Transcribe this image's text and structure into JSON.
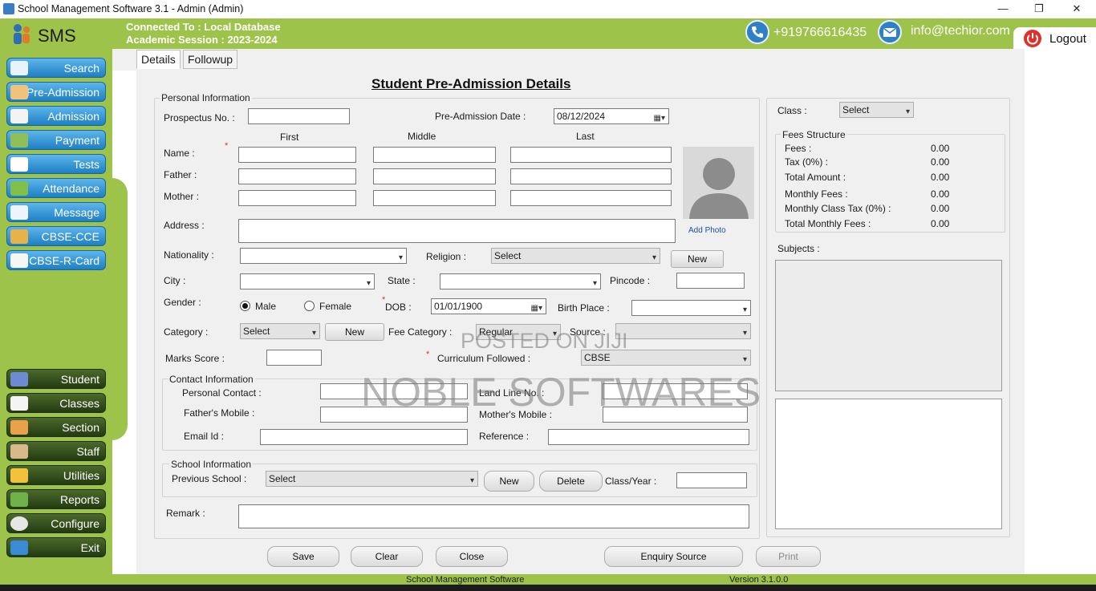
{
  "window": {
    "title": "School Management Software 3.1  -  Admin (Admin)",
    "minimize": "—",
    "restore": "❐",
    "close": "✕"
  },
  "header": {
    "logo_text": "SMS",
    "connected_to": "Connected To : Local Database",
    "academic_session": "Academic Session : 2023-2024",
    "phone": "+919766616435",
    "email": "info@techior.com",
    "logout_label": "Logout",
    "phone_icon": "phone-icon",
    "mail_icon": "mail-icon"
  },
  "sidebar": {
    "top_items": [
      {
        "label": "Search",
        "icon": "search-icon"
      },
      {
        "label": "Pre-Admission",
        "icon": "person-icon"
      },
      {
        "label": "Admission",
        "icon": "admission-icon"
      },
      {
        "label": "Payment",
        "icon": "payment-icon"
      },
      {
        "label": "Tests",
        "icon": "tests-icon"
      },
      {
        "label": "Attendance",
        "icon": "attendance-icon"
      },
      {
        "label": "Message",
        "icon": "message-icon"
      },
      {
        "label": "CBSE-CCE",
        "icon": "cbse-cce-icon"
      },
      {
        "label": "CBSE-R-Card",
        "icon": "report-card-icon"
      }
    ],
    "bottom_items": [
      {
        "label": "Student",
        "icon": "student-icon"
      },
      {
        "label": "Classes",
        "icon": "classes-icon"
      },
      {
        "label": "Section",
        "icon": "section-icon"
      },
      {
        "label": "Staff",
        "icon": "staff-icon"
      },
      {
        "label": "Utilities",
        "icon": "utilities-icon"
      },
      {
        "label": "Reports",
        "icon": "reports-icon"
      },
      {
        "label": "Configure",
        "icon": "configure-icon"
      },
      {
        "label": "Exit",
        "icon": "exit-icon"
      }
    ]
  },
  "tabs": [
    "Details",
    "Followup"
  ],
  "form": {
    "title": "Student Pre-Admission Details",
    "personal": {
      "legend": "Personal Information",
      "prospectus_label": "Prospectus No. :",
      "pre_admission_date_label": "Pre-Admission Date :",
      "pre_admission_date": "08/12/2024",
      "col_first": "First",
      "col_middle": "Middle",
      "col_last": "Last",
      "name_label": "Name :",
      "father_label": "Father :",
      "mother_label": "Mother :",
      "address_label": "Address :",
      "add_photo": "Add Photo",
      "nationality_label": "Nationality :",
      "religion_label": "Religion :",
      "religion_value": "Select",
      "new_label": "New",
      "city_label": "City :",
      "state_label": "State :",
      "pincode_label": "Pincode :",
      "gender_label": "Gender :",
      "male": "Male",
      "female": "Female",
      "dob_label": "DOB :",
      "dob": "01/01/1900",
      "birth_place_label": "Birth Place :",
      "category_label": "Category :",
      "category_value": "Select",
      "fee_category_label": "Fee Category :",
      "fee_category_value": "Regular",
      "source_label": "Source :",
      "marks_label": "Marks Score :",
      "curriculum_label": "Curriculum Followed :",
      "curriculum_value": "CBSE"
    },
    "contact": {
      "legend": "Contact Information",
      "personal_contact": "Personal Contact :",
      "land_line": "Land Line No. :",
      "father_mobile": "Father's Mobile :",
      "mother_mobile": "Mother's Mobile :",
      "email": "Email Id :",
      "reference": "Reference :"
    },
    "school": {
      "legend": "School Information",
      "previous_school": "Previous School :",
      "previous_school_value": "Select",
      "new_label": "New",
      "delete_label": "Delete",
      "class_year": "Class/Year :"
    },
    "remark_label": "Remark :"
  },
  "right_panel": {
    "class_label": "Class :",
    "class_value": "Select",
    "fees_legend": "Fees Structure",
    "fees": [
      {
        "label": "Fees :",
        "value": "0.00"
      },
      {
        "label": "Tax (0%) :",
        "value": "0.00"
      },
      {
        "label": "Total Amount :",
        "value": "0.00"
      },
      {
        "label": "Monthly Fees :",
        "value": "0.00"
      },
      {
        "label": "Monthly Class Tax (0%) :",
        "value": "0.00"
      },
      {
        "label": "Total Monthly Fees :",
        "value": "0.00"
      }
    ],
    "subjects_label": "Subjects :"
  },
  "actions": {
    "save": "Save",
    "clear": "Clear",
    "close": "Close",
    "enquiry_source": "Enquiry Source",
    "print": "Print"
  },
  "status": {
    "app_name": "School Management Software",
    "version": "Version 3.1.0.0"
  },
  "watermark": {
    "line1": "POSTED ON JIJI",
    "line2": "NOBLE SOFTWARES"
  }
}
